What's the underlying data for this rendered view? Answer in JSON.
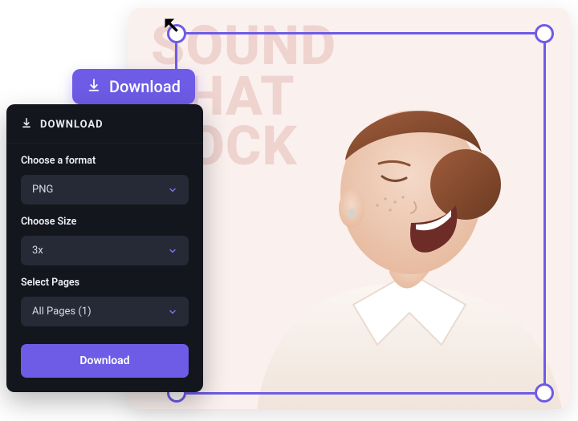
{
  "canvas": {
    "headline_line1": "SOUND",
    "headline_line2": "THAT",
    "headline_line3": "ROCK"
  },
  "floating_button": {
    "label": "Download",
    "icon": "download-icon"
  },
  "panel": {
    "title": "DOWNLOAD",
    "icon": "download-icon",
    "fields": {
      "format": {
        "label": "Choose a format",
        "value": "PNG"
      },
      "size": {
        "label": "Choose Size",
        "value": "3x"
      },
      "pages": {
        "label": "Select Pages",
        "value": "All Pages (1)"
      }
    },
    "submit_label": "Download"
  },
  "colors": {
    "accent": "#6E5BE6",
    "panel_bg": "#14161D",
    "select_bg": "#262A37",
    "canvas_bg": "#FAF0EE"
  }
}
